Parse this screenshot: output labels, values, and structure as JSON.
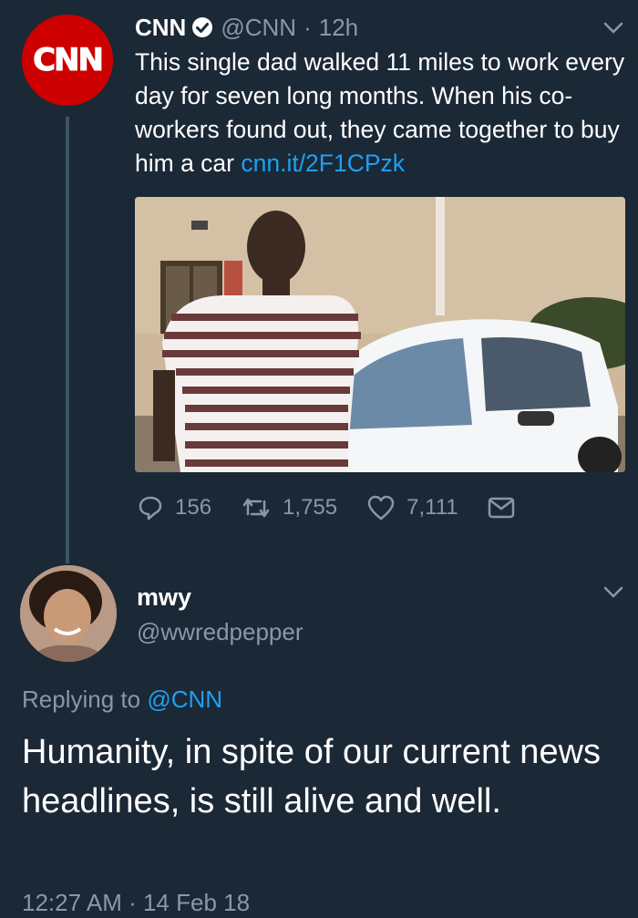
{
  "original_tweet": {
    "avatar_logo_text": "CNN",
    "display_name": "CNN",
    "handle": "@CNN",
    "separator": "·",
    "time_ago": "12h",
    "text": "This single dad walked 11 miles to work every day for seven long months. When his co-workers found out, they came together to buy him a car",
    "link": "cnn.it/2F1CPzk",
    "image_icon": "photo-of-man-with-white-car",
    "stats": {
      "replies": "156",
      "retweets": "1,755",
      "likes": "7,111"
    }
  },
  "reply_tweet": {
    "display_name": "mwy",
    "handle": "@wwredpepper",
    "replying_prefix": "Replying to",
    "replying_to": "@CNN",
    "text": "Humanity, in spite of our current news headlines, is still alive and well.",
    "timestamp": "12:27 AM · 14 Feb 18"
  },
  "colors": {
    "background": "#1b2836",
    "muted": "#8899a6",
    "link": "#1da1f2",
    "cnn_red": "#cc0000"
  }
}
